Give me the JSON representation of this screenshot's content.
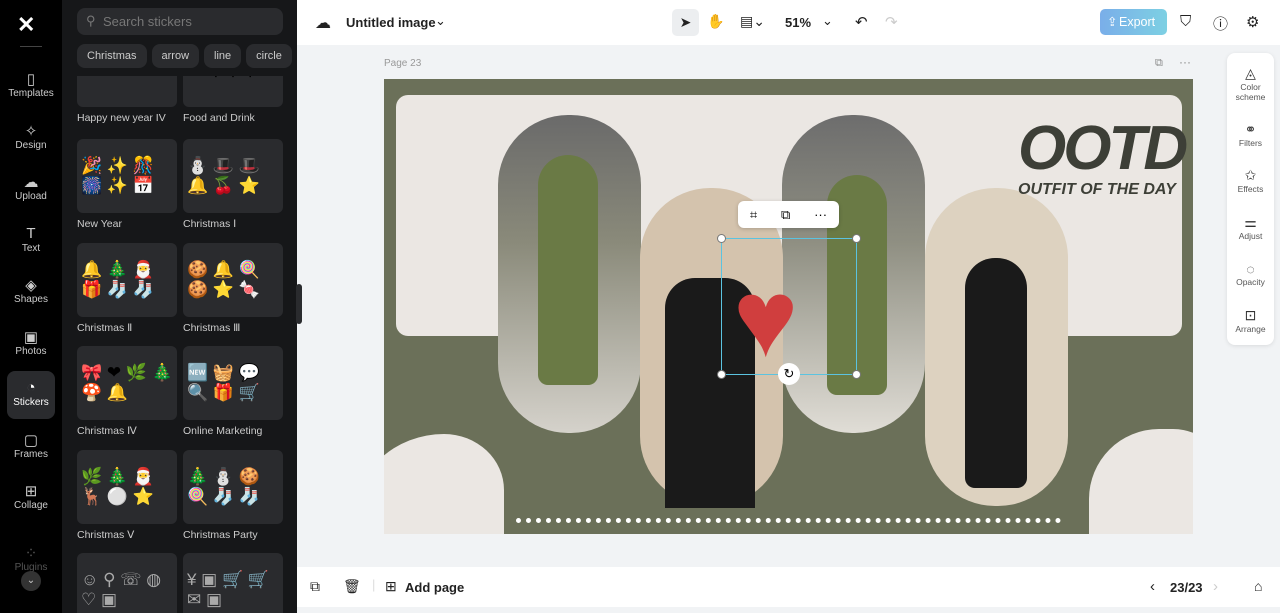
{
  "rail": {
    "items": [
      {
        "label": "Templates",
        "icon": "▯"
      },
      {
        "label": "Design",
        "icon": "✧"
      },
      {
        "label": "Upload",
        "icon": "☁"
      },
      {
        "label": "Text",
        "icon": "T"
      },
      {
        "label": "Shapes",
        "icon": "◈"
      },
      {
        "label": "Photos",
        "icon": "▣"
      },
      {
        "label": "Stickers",
        "icon": "◔"
      },
      {
        "label": "Frames",
        "icon": "▢"
      },
      {
        "label": "Collage",
        "icon": "⊞"
      },
      {
        "label": "Plugins",
        "icon": "⁘"
      }
    ]
  },
  "panel": {
    "search_placeholder": "Search stickers",
    "chips": [
      "Christmas",
      "arrow",
      "line",
      "circle"
    ],
    "cards": [
      {
        "label": "Happy new year IV",
        "icons": "✿ ⁘ ✕"
      },
      {
        "label": "Food and Drink",
        "icons": "⚲ ⚲ ⚲"
      },
      {
        "label": "New Year",
        "icons": "🎉 ✨ 🎊 🎆 ✨ 📅"
      },
      {
        "label": "Christmas Ⅰ",
        "icons": "⛄ 🎩 🎩 🔔 🍒 ⭐"
      },
      {
        "label": "Christmas Ⅱ",
        "icons": "🔔 🎄 🎅 🎁 🧦 🧦"
      },
      {
        "label": "Christmas Ⅲ",
        "icons": "🍪 🔔 🍭 🍪 ⭐ 🍬"
      },
      {
        "label": "Christmas Ⅳ",
        "icons": "🎀 ❤ 🌿 🎄 🍄 🔔"
      },
      {
        "label": "Online Marketing",
        "icons": "🆕 🧺 💬 🔍 🎁 🛒"
      },
      {
        "label": "Christmas Ⅴ",
        "icons": "🌿 🎄 🎅 🦌 ⚪ ⭐"
      },
      {
        "label": "Christmas Party",
        "icons": "🎄 ⛄ 🍪 🍭 🧦 🧦"
      },
      {
        "label": "",
        "icons": "☺ ⚲ ☏ ◍ ♡ ▣"
      },
      {
        "label": "",
        "icons": "¥ ▣ 🛒 🛒 ✉ ▣"
      }
    ]
  },
  "top": {
    "title": "Untitled image",
    "zoom": "51%",
    "export": "Export"
  },
  "page": {
    "label": "Page 23",
    "ootd": "OOTD",
    "subtitle": "OUTFIT OF THE DAY"
  },
  "right_panel": [
    {
      "label": "Color scheme",
      "icon": "◬"
    },
    {
      "label": "Filters",
      "icon": "⚭"
    },
    {
      "label": "Effects",
      "icon": "✩"
    },
    {
      "label": "Adjust",
      "icon": "⚌"
    },
    {
      "label": "Opacity",
      "icon": "◌"
    },
    {
      "label": "Arrange",
      "icon": "⊡"
    }
  ],
  "bottom": {
    "add_page": "Add page",
    "page_count": "23/23"
  }
}
